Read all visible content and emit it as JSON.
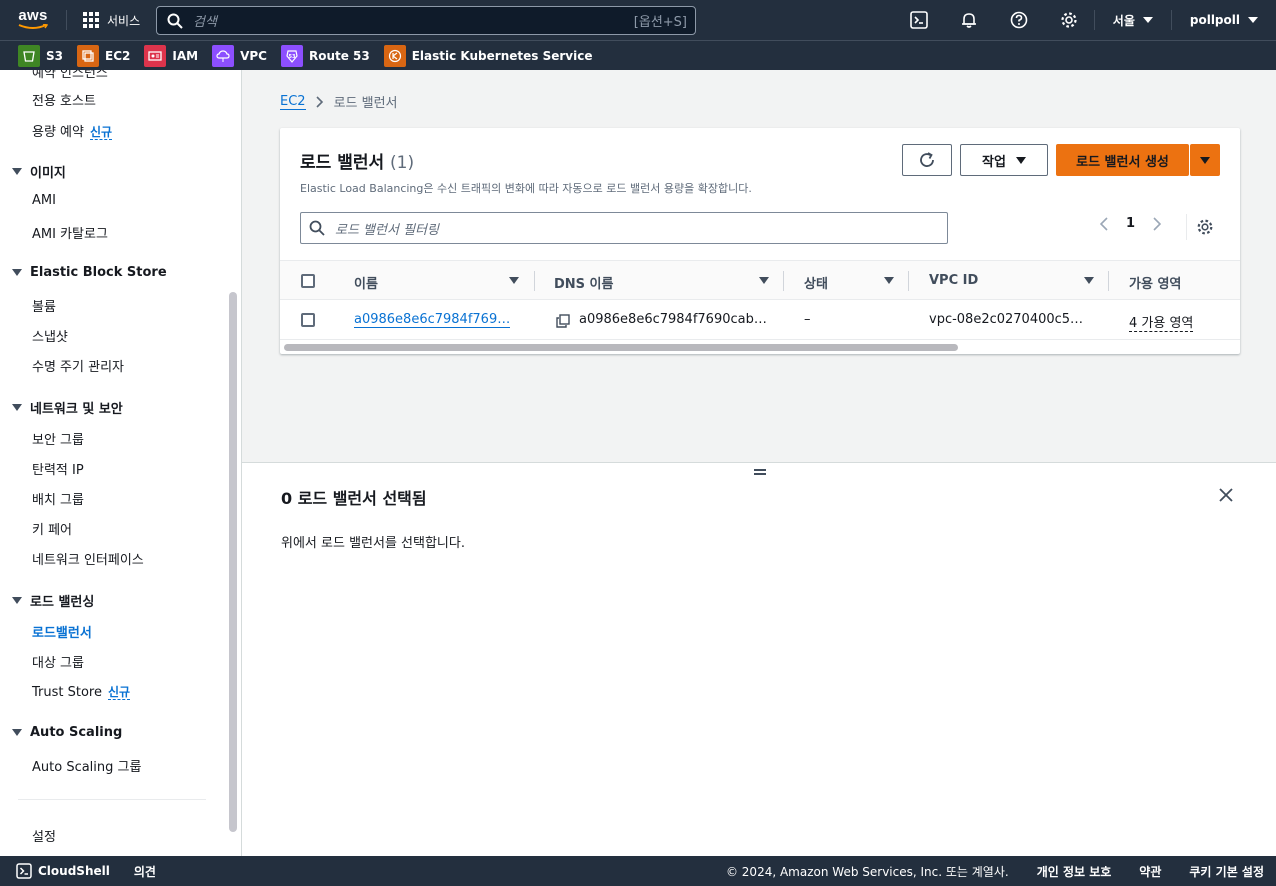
{
  "colors": {
    "nav_bg": "#232f3e",
    "link": "#0972d3",
    "primary": "#ec7211"
  },
  "topnav": {
    "logo": "aws",
    "services_label": "서비스",
    "search_placeholder": "검색",
    "search_shortcut": "[옵션+S]",
    "region": "서울",
    "account": "pollpoll",
    "icons": [
      "cloudshell-icon",
      "bell-icon",
      "help-icon",
      "settings-icon"
    ]
  },
  "favorites": [
    {
      "label": "S3",
      "color": "#3f8624"
    },
    {
      "label": "EC2",
      "color": "#d86613"
    },
    {
      "label": "IAM",
      "color": "#dd344c"
    },
    {
      "label": "VPC",
      "color": "#8c4fff"
    },
    {
      "label": "Route 53",
      "color": "#8c4fff"
    },
    {
      "label": "Elastic Kubernetes Service",
      "color": "#d86613"
    }
  ],
  "sidebar": {
    "cut_item": "예약 인스턴스",
    "items_top": [
      "전용 호스트",
      "용량 예약"
    ],
    "new_badge": "신규",
    "sections": [
      {
        "title": "이미지",
        "items": [
          "AMI",
          "AMI 카탈로그"
        ]
      },
      {
        "title": "Elastic Block Store",
        "items": [
          "볼륨",
          "스냅샷",
          "수명 주기 관리자"
        ]
      },
      {
        "title": "네트워크 및 보안",
        "items": [
          "보안 그룹",
          "탄력적 IP",
          "배치 그룹",
          "키 페어",
          "네트워크 인터페이스"
        ]
      },
      {
        "title": "로드 밸런싱",
        "items": [
          "로드밸런서",
          "대상 그룹",
          "Trust Store"
        ]
      },
      {
        "title": "Auto Scaling",
        "items": [
          "Auto Scaling 그룹"
        ]
      }
    ],
    "settings": "설정"
  },
  "breadcrumb": {
    "root": "EC2",
    "current": "로드 밸런서"
  },
  "panel": {
    "title": "로드 밸런서",
    "count": "(1)",
    "description": "Elastic Load Balancing은 수신 트래픽의 변화에 따라 자동으로 로드 밸런서 용량을 확장합니다.",
    "actions_label": "작업",
    "create_label": "로드 밸런서 생성",
    "filter_placeholder": "로드 밸런서 필터링",
    "page": "1",
    "columns": [
      "이름",
      "DNS 이름",
      "상태",
      "VPC ID",
      "가용 영역"
    ],
    "rows": [
      {
        "name": "a0986e8e6c7984f769…",
        "dns": "a0986e8e6c7984f7690cab…",
        "state": "–",
        "vpc": "vpc-08e2c0270400c5…",
        "az": "4 가용 영역"
      }
    ]
  },
  "split": {
    "title": "0 로드 밸런서 선택됨",
    "message": "위에서 로드 밸런서를 선택합니다."
  },
  "footer": {
    "cloudshell": "CloudShell",
    "feedback": "의견",
    "copyright": "© 2024, Amazon Web Services, Inc. 또는 계열사.",
    "privacy": "개인 정보 보호",
    "terms": "약관",
    "cookies": "쿠키 기본 설정"
  }
}
